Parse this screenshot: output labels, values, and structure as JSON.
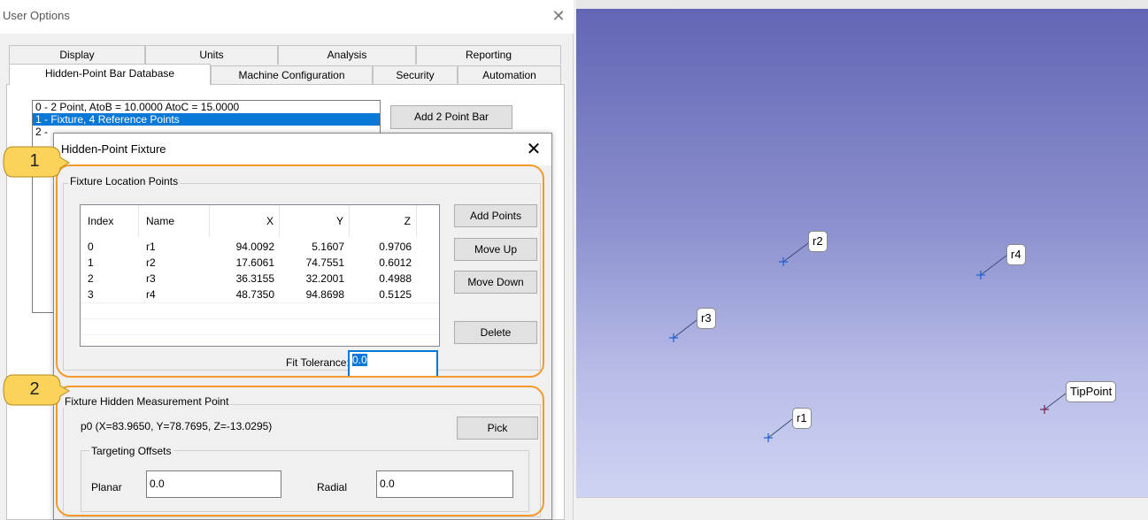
{
  "window": {
    "title": "User Options",
    "close_glyph": "✕"
  },
  "tabs_row1": [
    "Display",
    "Units",
    "Analysis",
    "Reporting"
  ],
  "tabs_row2": [
    "Hidden-Point Bar Database",
    "Machine Configuration",
    "Security",
    "Automation"
  ],
  "active_tab": "Hidden-Point Bar Database",
  "bar_list": {
    "items": [
      "0 - 2 Point, AtoB = 10.0000  AtoC = 15.0000",
      "1 - Fixture, 4 Reference Points",
      "2 -"
    ],
    "selected_index": 1
  },
  "add_2_point_bar_label": "Add 2 Point Bar",
  "dialog": {
    "title": "Hidden-Point Fixture",
    "close_glyph": "✕",
    "location_group_label": "Fixture Location Points",
    "columns": [
      "Index",
      "Name",
      "X",
      "Y",
      "Z"
    ],
    "rows": [
      [
        "0",
        "r1",
        "94.0092",
        "5.1607",
        "0.9706"
      ],
      [
        "1",
        "r2",
        "17.6061",
        "74.7551",
        "0.6012"
      ],
      [
        "2",
        "r3",
        "36.3155",
        "32.2001",
        "0.4988"
      ],
      [
        "3",
        "r4",
        "48.7350",
        "94.8698",
        "0.5125"
      ]
    ],
    "buttons": {
      "add_points": "Add Points",
      "move_up": "Move Up",
      "move_down": "Move Down",
      "delete": "Delete",
      "pick": "Pick"
    },
    "fit_tolerance_label": "Fit Tolerance:",
    "fit_tolerance_value": "0.0",
    "hidden_group_label": "Fixture Hidden Measurement Point",
    "hidden_point_text": "p0  (X=83.9650, Y=78.7695, Z=-13.0295)",
    "offsets_group_label": "Targeting Offsets",
    "planar_label": "Planar",
    "planar_value": "0.0",
    "radial_label": "Radial",
    "radial_value": "0.0"
  },
  "callouts": [
    "1",
    "2"
  ],
  "viewport": {
    "points": [
      {
        "label": "r2",
        "marker_color": "#1a5fd8"
      },
      {
        "label": "r4",
        "marker_color": "#1a5fd8"
      },
      {
        "label": "r3",
        "marker_color": "#1a5fd8"
      },
      {
        "label": "r1",
        "marker_color": "#1a5fd8"
      },
      {
        "label": "TipPoint",
        "marker_color": "#7a1e4a"
      }
    ]
  },
  "colors": {
    "callout_fill": "#fbd35a",
    "highlight_frame": "#f29a2e",
    "selection": "#0a78d7"
  }
}
